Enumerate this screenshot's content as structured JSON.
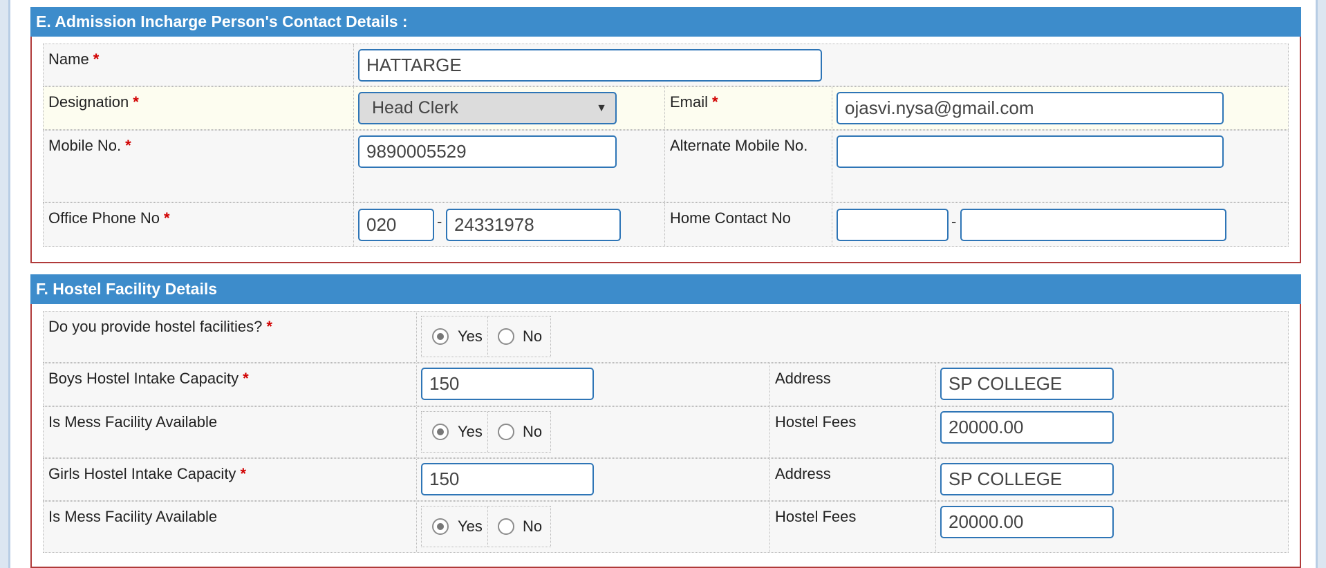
{
  "section_e": {
    "title": "E.  Admission Incharge Person's Contact Details :",
    "required_mark": "*",
    "name_label": "Name",
    "name_value": "HATTARGE",
    "designation_label": "Designation",
    "designation_value": "Head Clerk",
    "designation_arrow": "▼",
    "email_label": "Email",
    "email_value": "ojasvi.nysa@gmail.com",
    "mobile_label": "Mobile No.",
    "mobile_value": "9890005529",
    "alt_mobile_label": "Alternate Mobile No.",
    "alt_mobile_value": "",
    "office_phone_label": "Office Phone No",
    "office_phone_code": "020",
    "office_phone_number": "24331978",
    "home_contact_label": "Home Contact No",
    "home_contact_code": "",
    "home_contact_number": "",
    "separator": "-"
  },
  "section_f": {
    "title": "F.  Hostel Facility Details",
    "required_mark": "*",
    "hostel_question": "Do you provide hostel facilities?",
    "yes_label": "Yes",
    "no_label": "No",
    "hostel_selected": "Yes",
    "boys_capacity_label": "Boys Hostel Intake Capacity",
    "boys_capacity_value": "150",
    "address_label": "Address",
    "boys_address_value": "SP COLLEGE",
    "mess_label": "Is Mess Facility Available",
    "boys_mess_selected": "Yes",
    "fees_label": "Hostel Fees",
    "boys_fees_value": "20000.00",
    "girls_capacity_label": "Girls Hostel Intake Capacity",
    "girls_capacity_value": "150",
    "girls_address_value": "SP COLLEGE",
    "girls_mess_selected": "Yes",
    "girls_fees_value": "20000.00"
  },
  "colors": {
    "header_bg": "#3d8ccb",
    "section_border": "#b03a3a",
    "input_border": "#2e75b6",
    "required": "#d10000",
    "highlight_row": "#fdfdf0"
  }
}
